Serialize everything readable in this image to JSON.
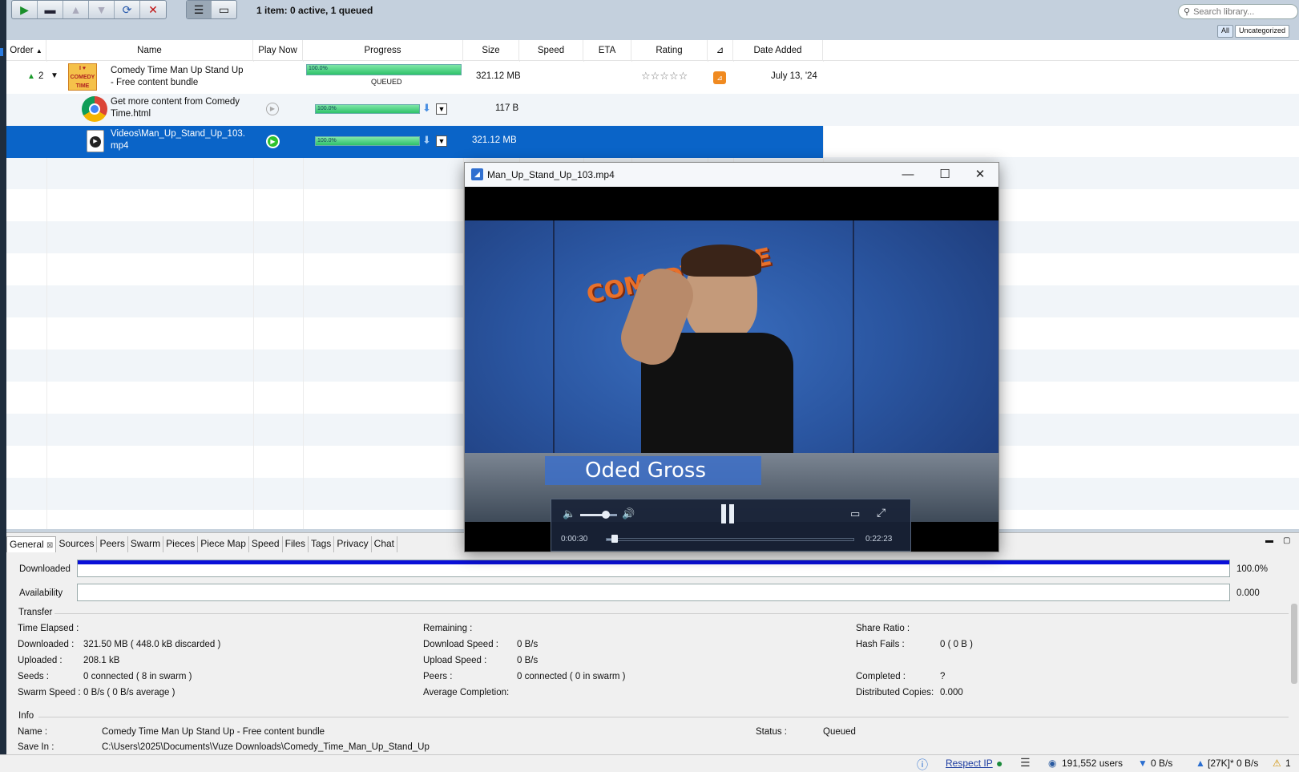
{
  "toolbar": {
    "summary": "1 item: 0 active, 1 queued",
    "search_placeholder": "Search library...",
    "tag_all": "All",
    "tag_uncategorized": "Uncategorized"
  },
  "table": {
    "headers": {
      "order": "Order",
      "name": "Name",
      "play_now": "Play Now",
      "progress": "Progress",
      "size": "Size",
      "speed": "Speed",
      "eta": "ETA",
      "rating": "Rating",
      "date_added": "Date Added"
    },
    "rows": [
      {
        "order": "2",
        "name_line1": "Comedy Time Man Up Stand Up",
        "name_line2": "- Free content bundle",
        "progress_label": "100.0%",
        "progress": 1.0,
        "status": "QUEUED",
        "size": "321.12 MB",
        "rating": "☆☆☆☆☆",
        "date_added": "July 13, '24"
      },
      {
        "name_line1": "Get more content from Comedy",
        "name_line2": "Time.html",
        "progress_label": "100.0%",
        "progress": 1.0,
        "size": "117 B"
      },
      {
        "name_line1": "Videos\\Man_Up_Stand_Up_103.",
        "name_line2": "mp4",
        "progress_label": "100.0%",
        "progress": 1.0,
        "size": "321.12 MB"
      }
    ]
  },
  "video_window": {
    "title": "Man_Up_Stand_Up_103.mp4",
    "caption": "Oded Gross",
    "time_current": "0:00:30",
    "time_total": "0:22:23",
    "seek_progress": 0.022,
    "volume_level": 0.7,
    "logo_text": "COMEDY TIME"
  },
  "details": {
    "tabs": [
      "General",
      "Sources",
      "Peers",
      "Swarm",
      "Pieces",
      "Piece Map",
      "Speed",
      "Files",
      "Tags",
      "Privacy",
      "Chat"
    ],
    "downloaded_label": "Downloaded",
    "downloaded_value": "100.0%",
    "downloaded_progress": 1.0,
    "availability_label": "Availability",
    "availability_value": "0.000",
    "transfer_heading": "Transfer",
    "info_heading": "Info",
    "col1": [
      {
        "label": "Time Elapsed :",
        "value": ""
      },
      {
        "label": "Downloaded :",
        "value": "321.50 MB ( 448.0 kB discarded )"
      },
      {
        "label": "Uploaded :",
        "value": "208.1 kB"
      },
      {
        "label": "Seeds :",
        "value": "0 connected ( 8 in swarm )"
      },
      {
        "label": "Swarm Speed :",
        "value": "0 B/s ( 0 B/s average )"
      }
    ],
    "col2": [
      {
        "label": "Remaining :",
        "value": ""
      },
      {
        "label": "Download Speed :",
        "value": "0 B/s"
      },
      {
        "label": "Upload Speed :",
        "value": "0 B/s"
      },
      {
        "label": "Peers :",
        "value": "0 connected ( 0 in swarm )"
      },
      {
        "label": "Average Completion:",
        "value": ""
      }
    ],
    "col3": [
      {
        "label": "Share Ratio :",
        "value": ""
      },
      {
        "label": "Hash Fails :",
        "value": "0 ( 0 B )"
      },
      {
        "label": "",
        "value": ""
      },
      {
        "label": "Completed :",
        "value": "?"
      },
      {
        "label": "Distributed Copies:",
        "value": "0.000"
      }
    ],
    "info_name_label": "Name :",
    "info_name_value": "Comedy Time Man Up Stand Up - Free content bundle",
    "info_status_label": "Status :",
    "info_status_value": "Queued",
    "info_save_label": "Save In :",
    "info_save_value": "C:\\Users\\2025\\Documents\\Vuze Downloads\\Comedy_Time_Man_Up_Stand_Up"
  },
  "status_bar": {
    "respect_ip": "Respect IP",
    "users": "191,552 users",
    "down_speed": "0 B/s",
    "up_speed": "[27K]* 0 B/s",
    "warnings": "1"
  }
}
